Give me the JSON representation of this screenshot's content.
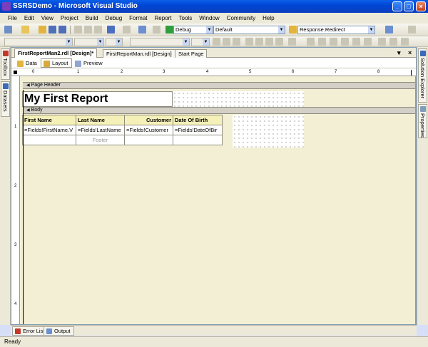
{
  "window": {
    "title": "SSRSDemo - Microsoft Visual Studio"
  },
  "menu": [
    "File",
    "Edit",
    "View",
    "Project",
    "Build",
    "Debug",
    "Format",
    "Report",
    "Tools",
    "Window",
    "Community",
    "Help"
  ],
  "toolbar": {
    "config_value": "Debug",
    "platform_value": "Default",
    "find_value": "Response.Redirect"
  },
  "left_tabs": {
    "toolbox": "Toolbox",
    "datasets": "Datasets"
  },
  "right_tabs": {
    "solution_explorer": "Solution Explorer",
    "properties": "Properties"
  },
  "doc_tabs": [
    "FirstReportMan2.rdl [Design]*",
    "FirstReportMan.rdl [Design]",
    "Start Page"
  ],
  "view_tabs": {
    "data": "Data",
    "layout": "Layout",
    "preview": "Preview",
    "active": "Layout"
  },
  "ruler": {
    "h_numbers": [
      "1",
      "2",
      "3",
      "4",
      "5",
      "6",
      "7",
      "8"
    ],
    "v_numbers": [
      "1",
      "2",
      "3",
      "4"
    ]
  },
  "report": {
    "page_header_label": "Page Header",
    "body_label": "Body",
    "title": "My First Report",
    "columns": [
      "First Name",
      "Last Name",
      "Customer",
      "Date Of Birth"
    ],
    "detail_row": [
      "=Fields!FirstName.V",
      "=Fields!LastName",
      "=Fields!Customer",
      "=Fields!DateOfBir"
    ],
    "footer_row": [
      "",
      "Footer",
      "",
      ""
    ]
  },
  "bottom_tabs": {
    "error_list": "Error List",
    "output": "Output"
  },
  "status": {
    "text": "Ready"
  }
}
